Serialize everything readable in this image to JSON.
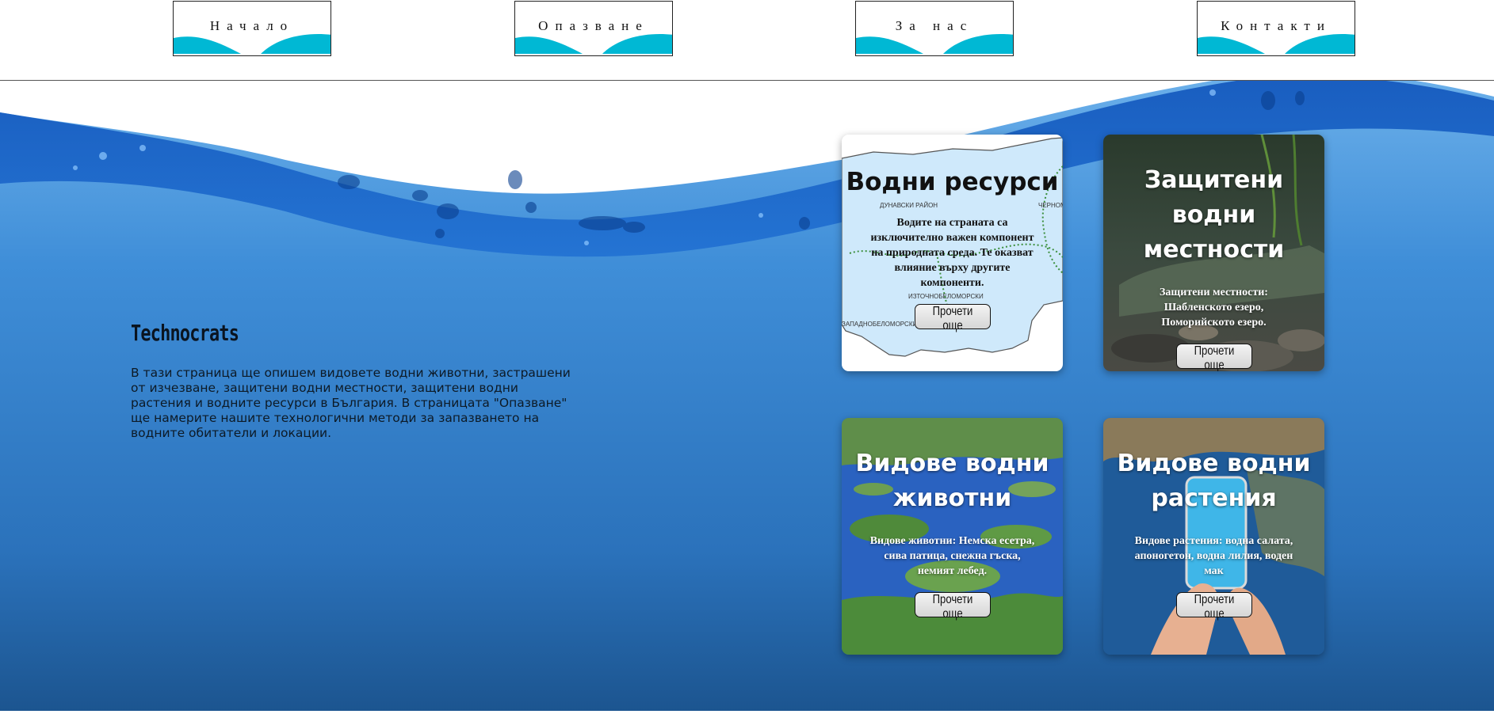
{
  "nav": {
    "items": [
      {
        "label": "Начало"
      },
      {
        "label": "Опазване"
      },
      {
        "label": "За нас"
      },
      {
        "label": "Контакти"
      }
    ]
  },
  "intro": {
    "title": "Technocrats",
    "text": "В тази страница ще опишем видовете водни животни, застрашени от изчезване, защитени водни местности, защитени водни растения и водните ресурси в България. В страницата \"Опазване\" ще намерите нашите технологични методи за запазването на водните обитатели и локации."
  },
  "cards": [
    {
      "title": "Водни ресурси",
      "text": "Водите на страната са изключително важен компонент на природната среда. Те оказват влияние върху другите компоненти.",
      "button": "Прочети още"
    },
    {
      "title": "Защитени водни местности",
      "text": "Защитени местности: Шабленското езеро, Поморийското езеро.",
      "button": "Прочети още"
    },
    {
      "title": "Видове водни животни",
      "text": "Видове животни: Немска есетра, сива патица, снежна гъска, немият лебед.",
      "button": "Прочети още"
    },
    {
      "title": "Видове водни растения",
      "text": "Видове растения: водна салата, апоногетон, водна лилия, воден мак",
      "button": "Прочети още"
    }
  ],
  "map_labels": {
    "a": "ДУНАВСКИ РАЙОН",
    "b": "ЧЕРНОМОРСКИ РАЙОН",
    "c": "ИЗТОЧНОБЕЛОМОРСКИ",
    "d": "ЗАПАДНОБЕЛОМОРСКИ"
  },
  "colors": {
    "accent": "#00b8d4",
    "water_top": "#2b7fd0",
    "water_bottom": "#1b5a9a"
  }
}
